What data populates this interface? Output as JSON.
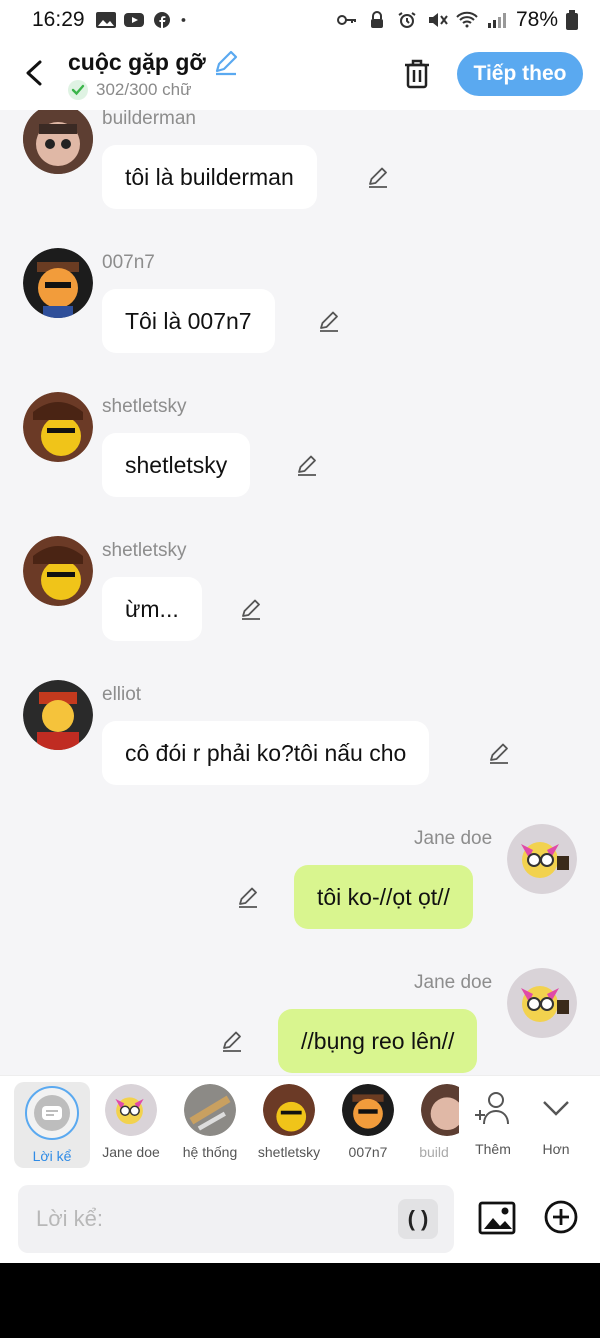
{
  "status_bar": {
    "time": "16:29",
    "battery": "78%"
  },
  "header": {
    "title": "cuộc gặp gỡ",
    "counter": "302/300 chữ",
    "next_label": "Tiếp theo"
  },
  "messages": [
    {
      "name": "builderman",
      "text": "tôi là builderman",
      "mine": false
    },
    {
      "name": "007n7",
      "text": "Tôi là 007n7",
      "mine": false
    },
    {
      "name": "shetletsky",
      "text": "shetletsky",
      "mine": false
    },
    {
      "name": "shetletsky",
      "text": "ừm...",
      "mine": false
    },
    {
      "name": "elliot",
      "text": "cô đói r phải ko?tôi nấu cho",
      "mine": false
    },
    {
      "name": "Jane doe",
      "text": "tôi ko-//ọt ọt//",
      "mine": true
    },
    {
      "name": "Jane doe",
      "text": "//bụng reo lên//",
      "mine": true
    }
  ],
  "characters": {
    "narrator": "Lời kể",
    "items": [
      "Jane doe",
      "hệ thống",
      "shetletsky",
      "007n7",
      "build"
    ],
    "add_label": "Thêm",
    "more_label": "Hơn"
  },
  "input": {
    "placeholder": "Lời kể:",
    "paren": "( )"
  },
  "colors": {
    "accent": "#5aa9f0",
    "my_bubble": "#d9f58f",
    "check_green": "#3bb54a"
  }
}
